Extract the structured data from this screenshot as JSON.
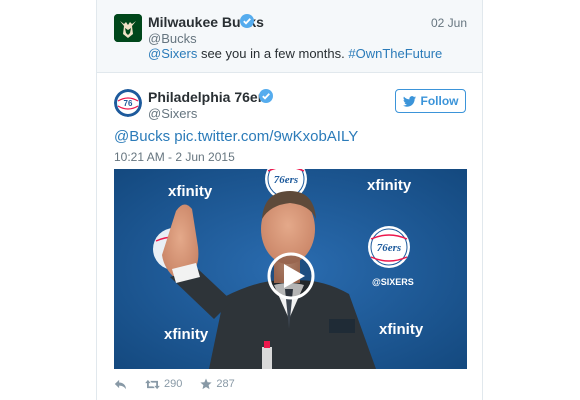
{
  "reply": {
    "name": "Milwaukee Bucks",
    "handle": "@Bucks",
    "date": "02 Jun",
    "mention": "@Sixers",
    "text": " see you in a few months. ",
    "hashtag": "#OwnTheFuture"
  },
  "tweet": {
    "name": "Philadelphia 76ers",
    "handle": "@Sixers",
    "follow_label": "Follow",
    "mention": "@Bucks",
    "link": "pic.twitter.com/9wKxobAILY",
    "timestamp": "10:21 AM - 2 Jun 2015",
    "media": {
      "sponsor_text": "xfinity",
      "logo_text": "76ers",
      "backdrop_text": "@SIXERS"
    },
    "retweets": "290",
    "favorites": "287"
  },
  "colors": {
    "link": "#2b7bb9",
    "verified": "#55acee",
    "follow": "#3b94d9",
    "bucks_green": "#00471b",
    "sixers_blue": "#1d5a9c",
    "sixers_red": "#ed174c"
  }
}
